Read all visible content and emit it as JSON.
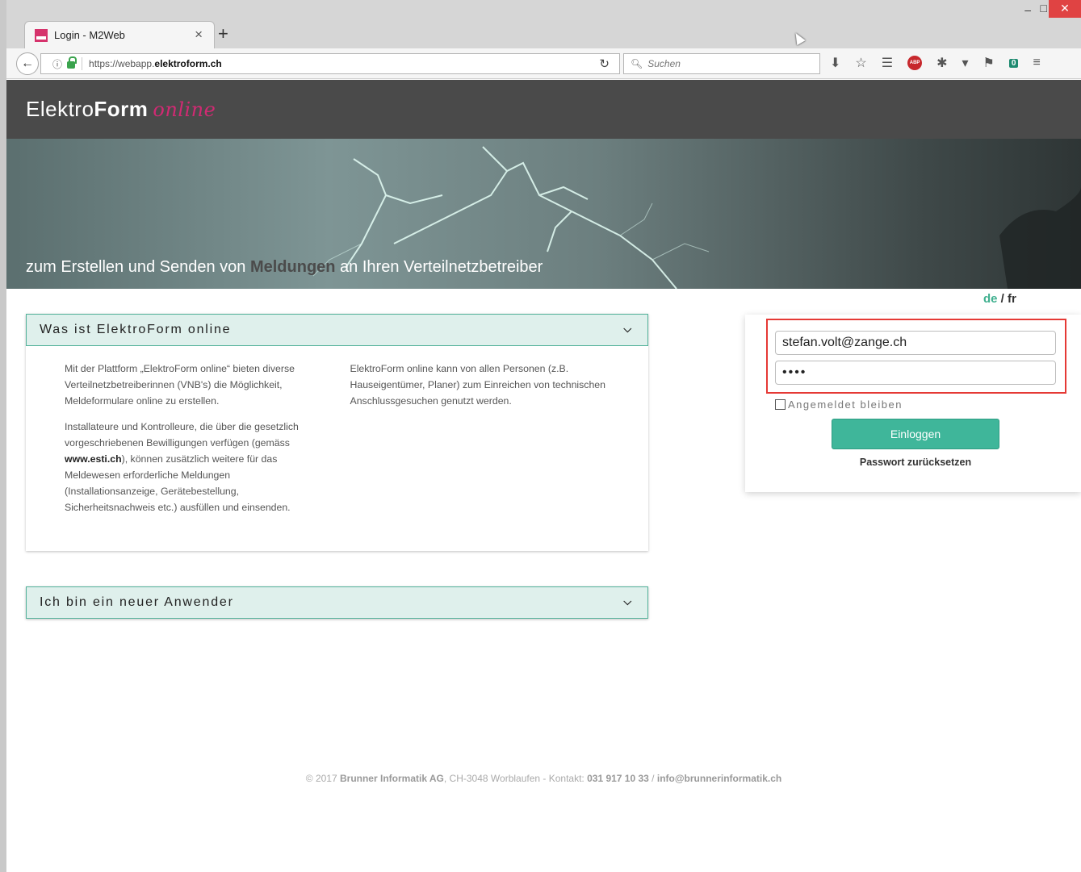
{
  "browser": {
    "tab_title": "Login - M2Web",
    "tab_close": "×",
    "new_tab": "+",
    "url_domain_prefix": "https://webapp.",
    "url_domain_bold": "elektroform.ch",
    "search_placeholder": "Suchen",
    "badge_count": "0",
    "abp_label": "ABP"
  },
  "header": {
    "logo_light": "Elektro",
    "logo_bold": "Form",
    "logo_script": "online"
  },
  "banner": {
    "tagline_pre": "zum Erstellen und Senden von ",
    "tagline_highlight": "Meldungen",
    "tagline_post": " an Ihren Verteilnetzbetreiber"
  },
  "lang": {
    "de": "de",
    "sep": " / ",
    "fr": "fr"
  },
  "panel_about": {
    "title": "Was ist ElektroForm online",
    "col1_p1": "Mit der Plattform „ElektroForm online“ bieten diverse Verteilnetzbetreiberinnen (VNB's) die Möglichkeit, Meldeformulare online zu erstellen.",
    "col1_p2_pre": "Installateure und Kontrolleure, die über die gesetzlich vorgeschriebenen Bewilligungen verfügen (gemäss ",
    "col1_p2_link": "www.esti.ch",
    "col1_p2_post": "), können zusätzlich weitere für das Meldewesen erforderliche Meldungen (Installationsanzeige, Gerätebestellung, Sicherheitsnachweis etc.) ausfüllen und einsenden.",
    "col2_p1": "ElektroForm online kann von allen Personen (z.B. Hauseigentümer, Planer) zum Einreichen von technischen Anschlussgesuchen genutzt werden."
  },
  "panel_new": {
    "title": "Ich bin ein neuer Anwender"
  },
  "login": {
    "email_value": "stefan.volt@zange.ch",
    "password_value": "••••",
    "remember_label": "Angemeldet bleiben",
    "login_button": "Einloggen",
    "reset_link": "Passwort zurücksetzen"
  },
  "footer": {
    "pre": "© 2017 ",
    "company": "Brunner Informatik AG",
    "mid": ", CH-3048 Worblaufen - Kontakt: ",
    "phone": "031 917 10 33",
    "sep": " / ",
    "email": "info@brunnerinformatik.ch"
  }
}
